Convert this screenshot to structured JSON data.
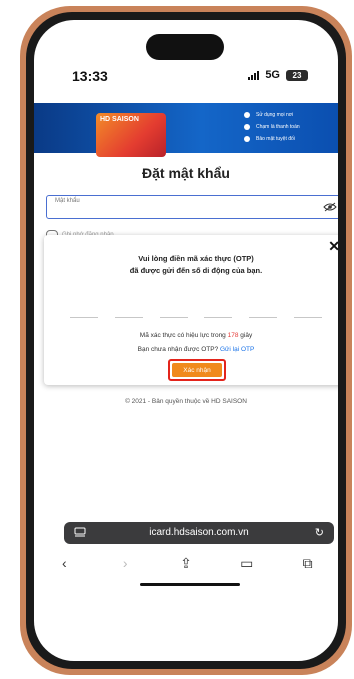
{
  "status": {
    "time": "13:33",
    "network": "5G",
    "battery": "23"
  },
  "banner": {
    "card_logo": "HD SAISON",
    "items": [
      "Sử dụng mọi nơi",
      "Chạm là thanh toán",
      "Bảo mật tuyệt đối"
    ]
  },
  "form": {
    "title": "Đặt mật khẩu",
    "password_label": "Mật khẩu",
    "remember_label": "Ghi nhớ đăng nhập"
  },
  "otp_modal": {
    "title_line1": "Vui lòng điền mã xác thực (OTP)",
    "title_line2": "đã được gửi đến số di động của bạn.",
    "validity_prefix": "Mã xác thực có hiệu lực trong ",
    "validity_seconds": "178",
    "validity_suffix": " giây",
    "resend_prefix": "Bạn chưa nhận được OTP? ",
    "resend_link": "Gửi lại OTP",
    "confirm_label": "Xác nhận",
    "close_glyph": "✕",
    "slot_count": 6
  },
  "footer": {
    "copyright": "© 2021 - Bản quyền thuộc về HD SAISON"
  },
  "browser": {
    "url": "icard.hdsaison.com.vn",
    "toolbar_icons": [
      "back-icon",
      "forward-icon",
      "share-icon",
      "bookmarks-icon",
      "tabs-icon"
    ]
  },
  "colors": {
    "accent_orange": "#f08a1c",
    "highlight_red": "#e3241b",
    "link_blue": "#1a73e8",
    "phone_frame": "#c9835a"
  }
}
